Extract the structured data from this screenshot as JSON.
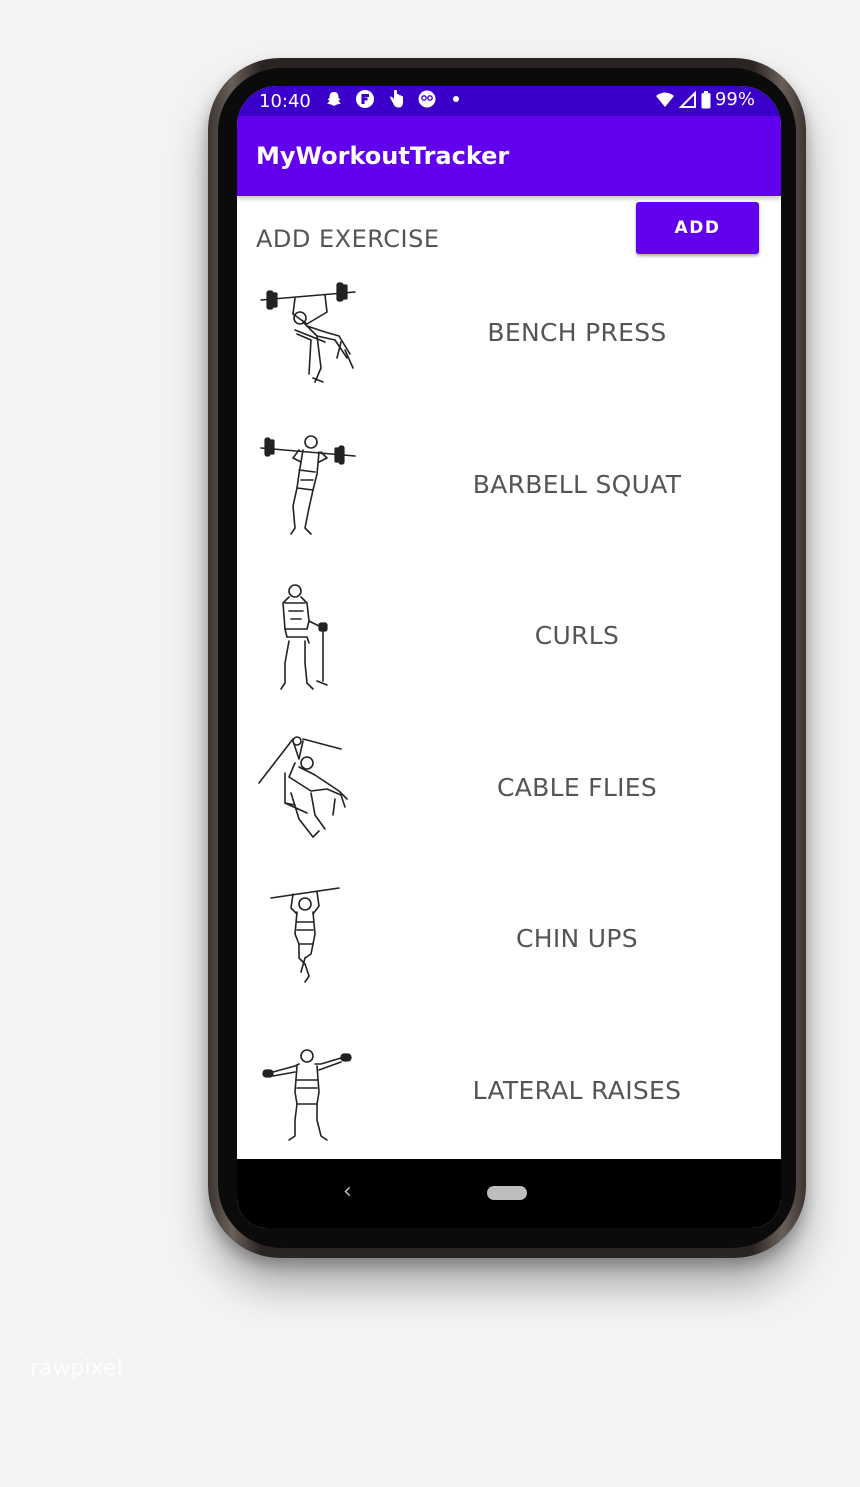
{
  "status_bar": {
    "time": "10:40",
    "battery": "99%",
    "icons_left": [
      "snapchat-icon",
      "flipboard-icon",
      "hand-icon",
      "face-icon",
      "dot-icon"
    ],
    "icons_right": [
      "wifi-icon",
      "signal-icon",
      "battery-icon"
    ]
  },
  "app_bar": {
    "title": "MyWorkoutTracker"
  },
  "add_section": {
    "label": "ADD EXERCISE",
    "button_label": "ADD"
  },
  "exercises": [
    {
      "name": "BENCH PRESS",
      "icon": "bench-press-figure"
    },
    {
      "name": "BARBELL SQUAT",
      "icon": "barbell-squat-figure"
    },
    {
      "name": "CURLS",
      "icon": "curls-figure"
    },
    {
      "name": "CABLE FLIES",
      "icon": "cable-flies-figure"
    },
    {
      "name": "CHIN UPS",
      "icon": "chin-ups-figure"
    },
    {
      "name": "LATERAL RAISES",
      "icon": "lateral-raises-figure"
    }
  ],
  "nav": {
    "back_glyph": "‹"
  },
  "watermark": "rawpixel",
  "colors": {
    "primary": "#6200ee",
    "primary_dark": "#3a00c9",
    "text": "#555555"
  }
}
